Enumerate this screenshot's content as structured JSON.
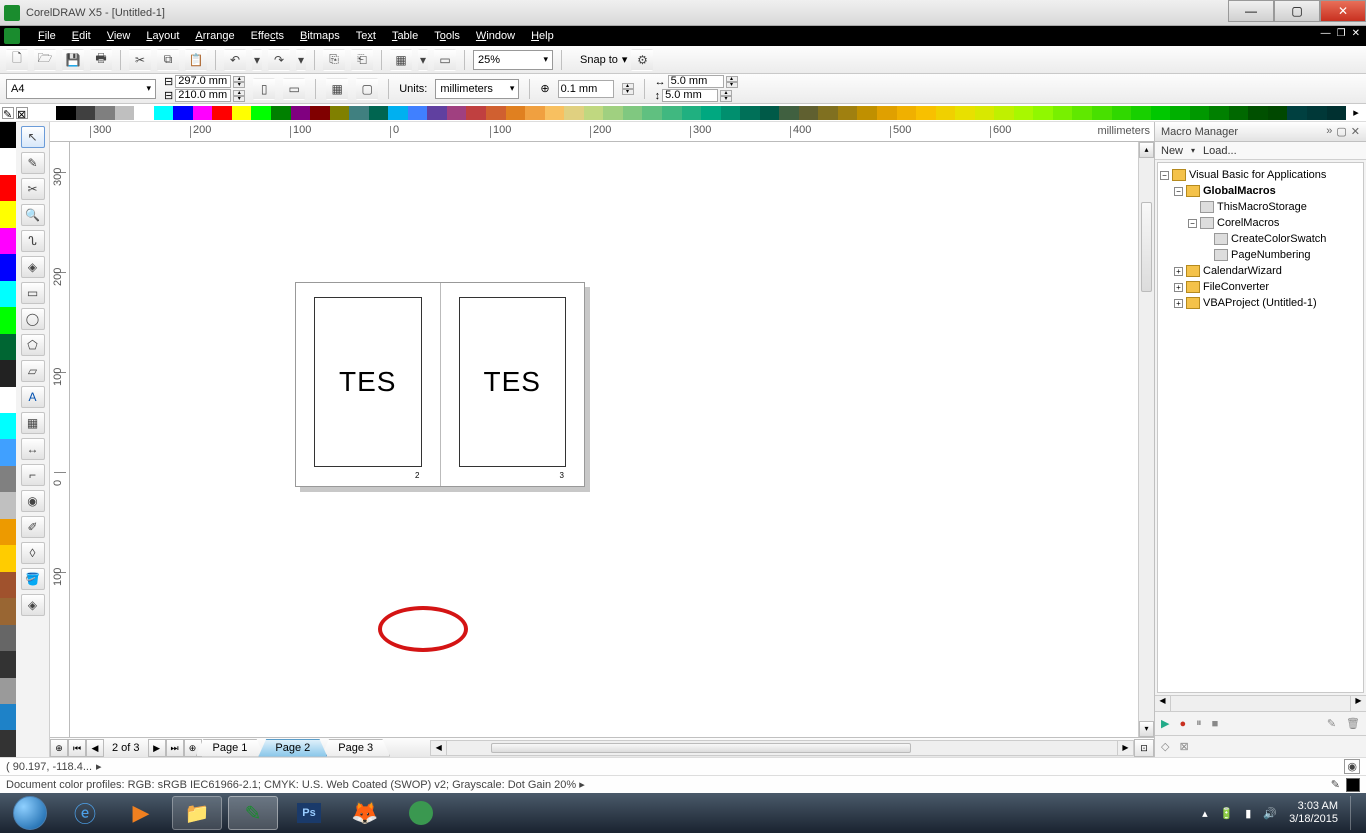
{
  "app_title": "CorelDRAW X5 - [Untitled-1]",
  "menu": [
    "File",
    "Edit",
    "View",
    "Layout",
    "Arrange",
    "Effects",
    "Bitmaps",
    "Text",
    "Table",
    "Tools",
    "Window",
    "Help"
  ],
  "zoom": "25%",
  "snap_label": "Snap to",
  "prop": {
    "paper": "A4",
    "width": "297.0 mm",
    "height": "210.0 mm",
    "units_label": "Units:",
    "units": "millimeters",
    "nudge": "0.1 mm",
    "dup_x": "5.0 mm",
    "dup_y": "5.0 mm"
  },
  "ruler_h_labels": [
    "300",
    "200",
    "100",
    "0",
    "100",
    "200",
    "300",
    "400",
    "500",
    "600"
  ],
  "ruler_h_unit": "millimeters",
  "ruler_v_labels": [
    "300",
    "200",
    "100",
    "0",
    "100"
  ],
  "ruler_v_unit": "millimeters",
  "canvas": {
    "page_text": "TES",
    "page_num_left": "2",
    "page_num_right": "3"
  },
  "pagenav": {
    "counter": "2 of 3",
    "tabs": [
      "Page 1",
      "Page 2",
      "Page 3"
    ]
  },
  "macro_panel": {
    "title": "Macro Manager",
    "new": "New",
    "load": "Load...",
    "tree": {
      "root": "Visual Basic for Applications",
      "global": "GlobalMacros",
      "this_storage": "ThisMacroStorage",
      "corel": "CorelMacros",
      "create_swatch": "CreateColorSwatch",
      "page_num": "PageNumbering",
      "cal": "CalendarWizard",
      "file_conv": "FileConverter",
      "vba_proj": "VBAProject (Untitled-1)"
    }
  },
  "status": {
    "coords": "( 90.197, -118.4...",
    "profiles": "Document color profiles: RGB: sRGB IEC61966-2.1; CMYK: U.S. Web Coated (SWOP) v2; Grayscale: Dot Gain 20% ▸"
  },
  "taskbar": {
    "time": "3:03 AM",
    "date": "3/18/2015"
  },
  "palette_colors": [
    "#000000",
    "#404040",
    "#7f7f7f",
    "#bfbfbf",
    "#ffffff",
    "#00ffff",
    "#0000ff",
    "#ff00ff",
    "#ff0000",
    "#ffff00",
    "#00ff00",
    "#008000",
    "#800080",
    "#800000",
    "#808000",
    "#408080",
    "#006550",
    "#00b0f0",
    "#4080ff",
    "#6040a0",
    "#a04080",
    "#c04040",
    "#d06030",
    "#e08020",
    "#f0a040",
    "#f8c060",
    "#e0d080",
    "#c0d880",
    "#a0d080",
    "#80c880",
    "#60c080",
    "#40b880",
    "#20b080",
    "#00a880",
    "#008f6e",
    "#007058",
    "#005a48",
    "#406040",
    "#606030",
    "#807020",
    "#a08010",
    "#c09000",
    "#e0a000",
    "#f0b000",
    "#f8c000",
    "#f0d000",
    "#e8e000",
    "#d8e800",
    "#c0f000",
    "#a8f800",
    "#90f800",
    "#78f000",
    "#60e800",
    "#48e000",
    "#30d800",
    "#18d000",
    "#00c800",
    "#00b000",
    "#009800",
    "#008000",
    "#006800",
    "#005000",
    "#004800",
    "#004040",
    "#003838",
    "#003030"
  ],
  "left_colors": [
    "#000000",
    "#ffffff",
    "#ff0000",
    "#ffff00",
    "#ff00ff",
    "#0000ff",
    "#00ffff",
    "#00ff00",
    "#006633",
    "#222222",
    "#ffffff",
    "#00ffff",
    "#40a0ff",
    "#808080",
    "#c0c0c0",
    "#ed9a00",
    "#ffcc00",
    "#a0522d",
    "#996633",
    "#666666",
    "#333333",
    "#9a9a9a",
    "#1e82c8",
    "#333333"
  ]
}
